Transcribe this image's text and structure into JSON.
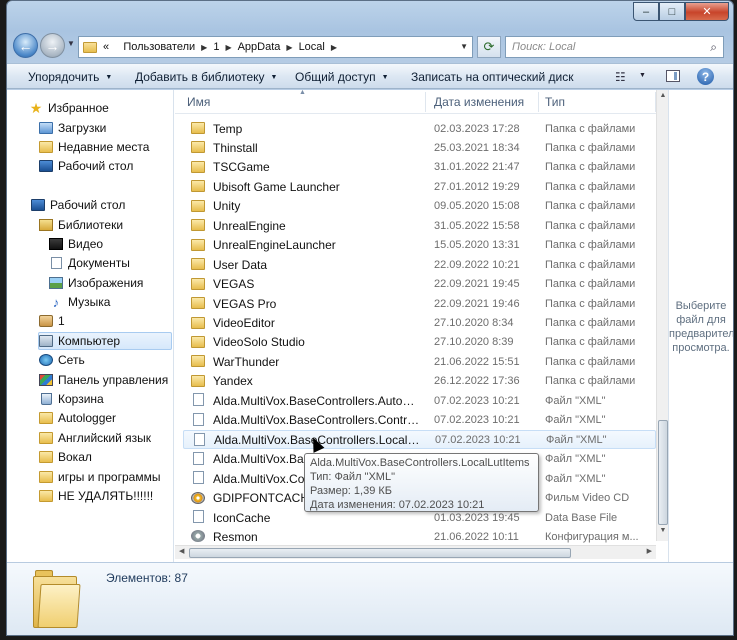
{
  "window": {
    "caption": {
      "minimize": "–",
      "maximize": "□",
      "close": "✕"
    }
  },
  "address": {
    "lead": "«",
    "crumbs": [
      "Пользователи",
      "1",
      "AppData",
      "Local"
    ],
    "search_placeholder": "Поиск: Local"
  },
  "toolbar": {
    "organize": "Упорядочить",
    "add_library": "Добавить в библиотеку",
    "share": "Общий доступ",
    "burn": "Записать на оптический диск"
  },
  "nav": {
    "favorites": "Избранное",
    "downloads": "Загрузки",
    "recent": "Недавние места",
    "desktop_fav": "Рабочий стол",
    "desktop": "Рабочий стол",
    "libraries": "Библиотеки",
    "video": "Видео",
    "documents": "Документы",
    "images": "Изображения",
    "music": "Музыка",
    "user": "1",
    "computer": "Компьютер",
    "network": "Сеть",
    "control_panel": "Панель управления",
    "recycle": "Корзина",
    "autologger": "Autologger",
    "english": "Английский язык",
    "vocal": "Вокал",
    "games": "игры и программы",
    "nodelete": "НЕ УДАЛЯТЬ!!!!!!"
  },
  "columns": {
    "name": "Имя",
    "date": "Дата изменения",
    "type": "Тип"
  },
  "files": [
    {
      "name": "Temp",
      "date": "02.03.2023 17:28",
      "type": "Папка с файлами",
      "icon": "folder"
    },
    {
      "name": "Thinstall",
      "date": "25.03.2021 18:34",
      "type": "Папка с файлами",
      "icon": "folder"
    },
    {
      "name": "TSCGame",
      "date": "31.01.2022 21:47",
      "type": "Папка с файлами",
      "icon": "folder"
    },
    {
      "name": "Ubisoft Game Launcher",
      "date": "27.01.2012 19:29",
      "type": "Папка с файлами",
      "icon": "folder"
    },
    {
      "name": "Unity",
      "date": "09.05.2020 15:08",
      "type": "Папка с файлами",
      "icon": "folder"
    },
    {
      "name": "UnrealEngine",
      "date": "31.05.2022 15:58",
      "type": "Папка с файлами",
      "icon": "folder"
    },
    {
      "name": "UnrealEngineLauncher",
      "date": "15.05.2020 13:31",
      "type": "Папка с файлами",
      "icon": "folder"
    },
    {
      "name": "User Data",
      "date": "22.09.2022 10:21",
      "type": "Папка с файлами",
      "icon": "folder"
    },
    {
      "name": "VEGAS",
      "date": "22.09.2021 19:45",
      "type": "Папка с файлами",
      "icon": "folder"
    },
    {
      "name": "VEGAS Pro",
      "date": "22.09.2021 19:46",
      "type": "Папка с файлами",
      "icon": "folder"
    },
    {
      "name": "VideoEditor",
      "date": "27.10.2020 8:34",
      "type": "Папка с файлами",
      "icon": "folder"
    },
    {
      "name": "VideoSolo Studio",
      "date": "27.10.2020 8:39",
      "type": "Папка с файлами",
      "icon": "folder"
    },
    {
      "name": "WarThunder",
      "date": "21.06.2022 15:51",
      "type": "Папка с файлами",
      "icon": "folder"
    },
    {
      "name": "Yandex",
      "date": "26.12.2022 17:36",
      "type": "Папка с файлами",
      "icon": "folder"
    },
    {
      "name": "Alda.MultiVox.BaseControllers.AutoDispl...",
      "date": "07.02.2023 10:21",
      "type": "Файл \"XML\"",
      "icon": "file"
    },
    {
      "name": "Alda.MultiVox.BaseControllers.Controller...",
      "date": "07.02.2023 10:21",
      "type": "Файл \"XML\"",
      "icon": "file"
    },
    {
      "name": "Alda.MultiVox.BaseControllers.LocalLutIt...",
      "date": "07.02.2023 10:21",
      "type": "Файл \"XML\"",
      "icon": "file"
    },
    {
      "name": "Alda.MultiVox.BaseC",
      "date": "07.02.2023 10:21",
      "type": "Файл \"XML\"",
      "icon": "file"
    },
    {
      "name": "Alda.MultiVox.Confi",
      "date": "07.02.2023 10:21",
      "type": "Файл \"XML\"",
      "icon": "file"
    },
    {
      "name": "GDIPFONTCACHEV1",
      "date": "",
      "type": "Фильм Video CD",
      "icon": "disc"
    },
    {
      "name": "IconCache",
      "date": "01.03.2023 19:45",
      "type": "Data Base File",
      "icon": "file"
    },
    {
      "name": "Resmon",
      "date": "21.06.2022 10:11",
      "type": "Конфигурация м...",
      "icon": "gear"
    }
  ],
  "preview_text": "Выберите файл для предварительного просмотра.",
  "tooltip": {
    "title": "Alda.MultiVox.BaseControllers.LocalLutItems",
    "type": "Тип: Файл \"XML\"",
    "size": "Размер: 1,39 КБ",
    "modified": "Дата изменения: 07.02.2023 10:21"
  },
  "details": {
    "count": "Элементов: 87"
  }
}
